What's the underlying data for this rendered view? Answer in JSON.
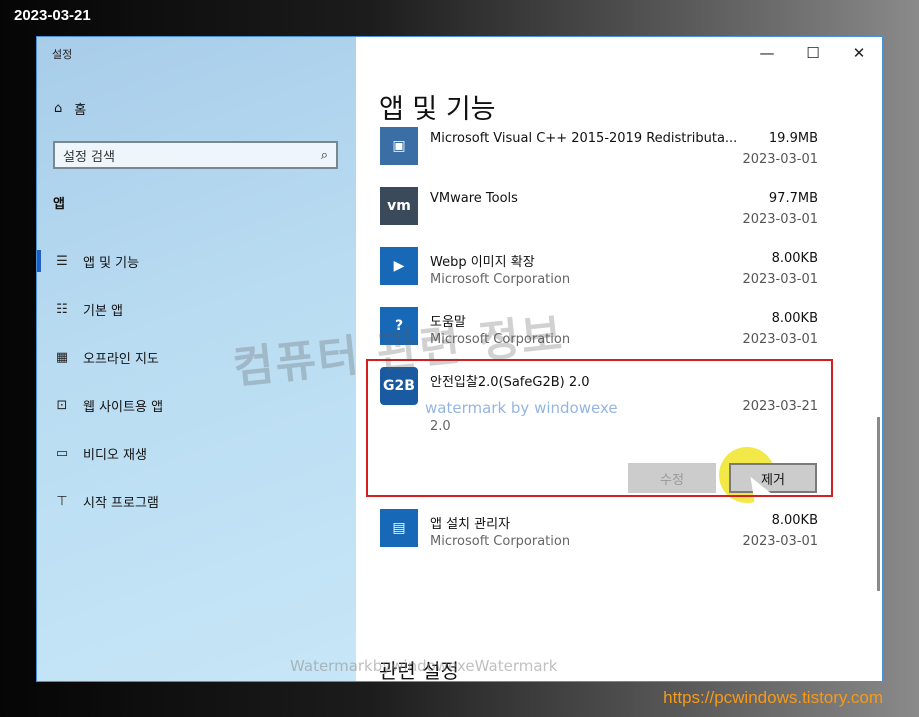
{
  "date_stamp": "2023-03-21",
  "window": {
    "title": "설정",
    "controls": {
      "minimize": "—",
      "maximize": "☐",
      "close": "✕"
    }
  },
  "sidebar": {
    "home_label": "홈",
    "search_placeholder": "설정 검색",
    "section_label": "앱",
    "items": [
      {
        "label": "앱 및 기능",
        "icon": "apps-features-icon",
        "active": true
      },
      {
        "label": "기본 앱",
        "icon": "default-apps-icon"
      },
      {
        "label": "오프라인 지도",
        "icon": "offline-maps-icon"
      },
      {
        "label": "웹 사이트용 앱",
        "icon": "apps-for-websites-icon"
      },
      {
        "label": "비디오 재생",
        "icon": "video-playback-icon"
      },
      {
        "label": "시작 프로그램",
        "icon": "startup-icon"
      }
    ]
  },
  "main": {
    "title": "앱 및 기능",
    "apps": [
      {
        "name": "Microsoft Visual C++ 2015-2019 Redistributa...",
        "publisher": "",
        "size": "19.9MB",
        "date": "2023-03-01",
        "icon": "installer-icon",
        "color": "#3a6ea5"
      },
      {
        "name": "VMware Tools",
        "publisher": "",
        "size": "97.7MB",
        "date": "2023-03-01",
        "icon": "vmware-icon",
        "color": "#3b4a5a"
      },
      {
        "name": "Webp 이미지 확장",
        "publisher": "Microsoft Corporation",
        "size": "8.00KB",
        "date": "2023-03-01",
        "icon": "webp-extension-icon",
        "color": "#1768b7"
      },
      {
        "name": "도움말",
        "publisher": "Microsoft Corporation",
        "size": "8.00KB",
        "date": "2023-03-01",
        "icon": "help-icon",
        "color": "#1768b7"
      },
      {
        "name": "안전입찰2.0(SafeG2B) 2.0",
        "publisher": "",
        "size": "",
        "date": "2023-03-21",
        "version": "2.0",
        "icon": "safeg2b-icon",
        "color": "#1a5aa0",
        "selected": true
      },
      {
        "name": "앱 설치 관리자",
        "publisher": "Microsoft Corporation",
        "size": "8.00KB",
        "date": "2023-03-01",
        "icon": "app-installer-icon",
        "color": "#1768b7"
      }
    ],
    "buttons": {
      "modify": "수정",
      "uninstall": "제거"
    },
    "related_settings": "관련 설정"
  },
  "watermarks": {
    "center": "컴퓨터 관련 정보",
    "small": "watermark by windowexe",
    "bottom": "WatermarkbywindowexeWatermark",
    "url": "https://pcwindows.tistory.com"
  }
}
